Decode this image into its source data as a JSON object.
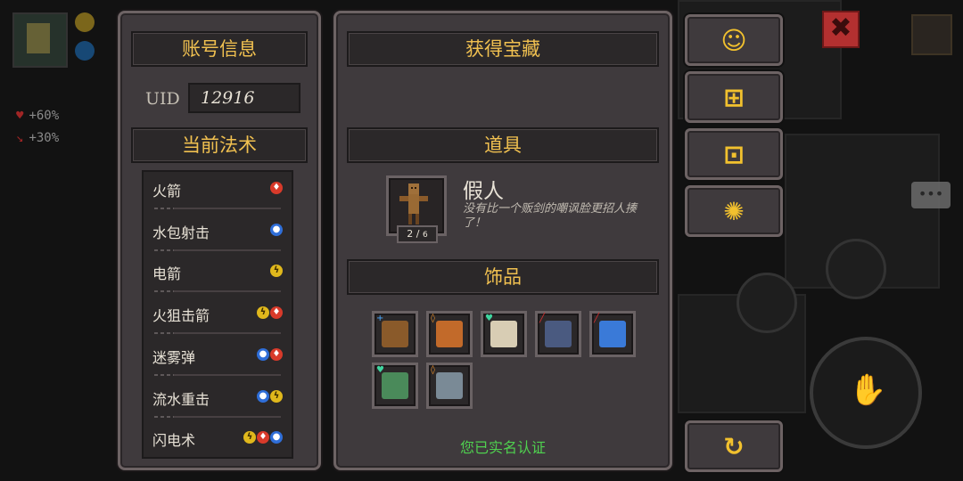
{
  "account_panel": {
    "title": "账号信息",
    "uid_label": "UID",
    "uid_value": "12916",
    "spells_title": "当前法术",
    "spells": [
      {
        "name": "火箭",
        "elements": [
          "fire"
        ]
      },
      {
        "name": "水包射击",
        "elements": [
          "water"
        ]
      },
      {
        "name": "电箭",
        "elements": [
          "thunder"
        ]
      },
      {
        "name": "火狙击箭",
        "elements": [
          "thunder",
          "fire"
        ]
      },
      {
        "name": "迷雾弹",
        "elements": [
          "water",
          "fire"
        ]
      },
      {
        "name": "流水重击",
        "elements": [
          "water",
          "thunder"
        ]
      },
      {
        "name": "闪电术",
        "elements": [
          "thunder",
          "fire",
          "water"
        ]
      }
    ]
  },
  "treasure_panel": {
    "title": "获得宝藏",
    "items_title": "道具",
    "item": {
      "name": "假人",
      "description": "没有比一个贩剑的嘲讽脸更招人揍了！",
      "count": "2",
      "max": "6"
    },
    "accessories_title": "饰品",
    "accessories": [
      {
        "icon": "backpack-icon",
        "badge": "+",
        "badge_color": "#4aa8ff",
        "color": "#8a5a2a"
      },
      {
        "icon": "treasure-bag-icon",
        "badge": "◊",
        "badge_color": "#e08a2a",
        "color": "#c26a2a"
      },
      {
        "icon": "bone-icon",
        "badge": "♥",
        "badge_color": "#3fd6a0",
        "color": "#d8cdb4"
      },
      {
        "icon": "stone-tablet-icon",
        "badge": "╱",
        "badge_color": "#d83030",
        "color": "#4a5a80"
      },
      {
        "icon": "lightning-shard-icon",
        "badge": "╱",
        "badge_color": "#d83030",
        "color": "#3a7ad8"
      },
      {
        "icon": "herb-mortar-icon",
        "badge": "♥",
        "badge_color": "#3fd6a0",
        "color": "#4a8a5a"
      },
      {
        "icon": "gear-orb-icon",
        "badge": "◊",
        "badge_color": "#e08a2a",
        "color": "#7a8a96"
      }
    ],
    "verified_text": "您已实名认证"
  },
  "side_buttons": [
    {
      "name": "support-button",
      "icon": "headset-icon",
      "glyph": "☺"
    },
    {
      "name": "gift-button",
      "icon": "gift-icon",
      "glyph": "⊞"
    },
    {
      "name": "community-button",
      "icon": "bilibili-icon",
      "glyph": "⊡"
    },
    {
      "name": "settings-button",
      "icon": "gear-icon",
      "glyph": "✺"
    },
    {
      "name": "restart-button",
      "icon": "refresh-icon",
      "glyph": "↻"
    }
  ],
  "hud": {
    "stat1": "+60%",
    "stat2": "+30%",
    "close_glyph": "✖"
  },
  "colors": {
    "accent_gold": "#f0c050",
    "verified_green": "#4fd14f",
    "panel_bg": "#3f3a3d"
  }
}
